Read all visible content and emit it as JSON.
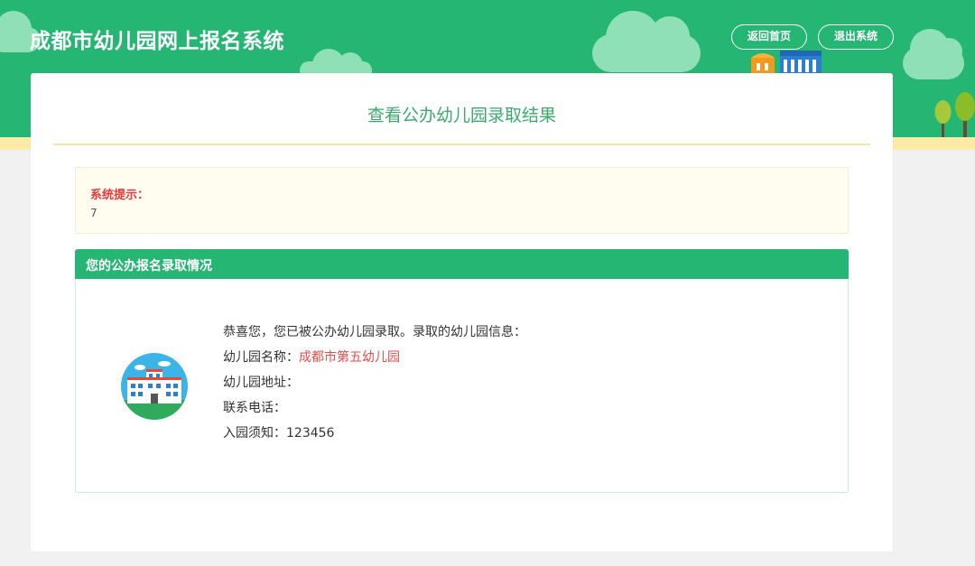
{
  "header": {
    "title": "成都市幼儿园网上报名系统",
    "home_button": "返回首页",
    "logout_button": "退出系统"
  },
  "page": {
    "title": "查看公办幼儿园录取结果"
  },
  "notice": {
    "label": "系统提示：",
    "text": "7"
  },
  "result": {
    "panel_title": "您的公办报名录取情况",
    "intro": "恭喜您，您已被公办幼儿园录取。录取的幼儿园信息：",
    "name_label": "幼儿园名称：",
    "name_value": "成都市第五幼儿园",
    "address_label": "幼儿园地址：",
    "address_value": "",
    "phone_label": "联系电话：",
    "phone_value": "",
    "notes_label": "入园须知：",
    "notes_value": "123456"
  },
  "icons": {
    "school": "school-building-icon",
    "decor_buildings": "kindergarten-buildings-icon",
    "decor_trees": "trees-icon"
  },
  "colors": {
    "brand_green": "#25b673",
    "title_green": "#3aaa6d",
    "alert_red": "#e43a3a",
    "strip_yellow": "#fdeaa6"
  }
}
